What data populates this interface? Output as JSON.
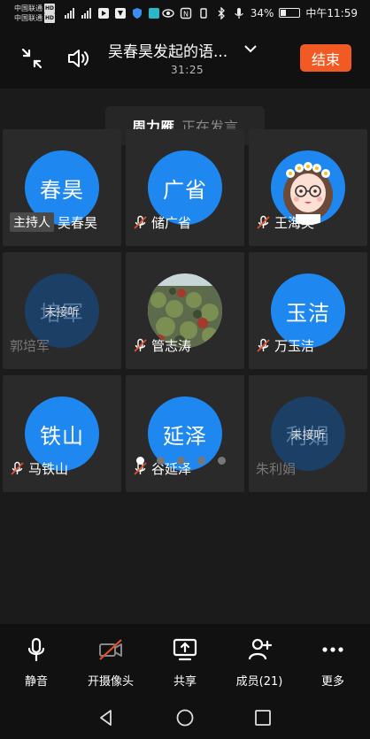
{
  "status_bar": {
    "carrier1": "中国联通",
    "carrier2": "中国联通",
    "hd": "HD",
    "battery": "34%",
    "time": "中午11:59"
  },
  "header": {
    "title": "吴春昊发起的语...",
    "timer": "31:25",
    "end_label": "结束"
  },
  "speaking": {
    "name": "周力雁",
    "status": "正在发言"
  },
  "participants": [
    {
      "avatar_text": "春昊",
      "name": "吴春昊",
      "host_badge": "主持人",
      "state": "joined"
    },
    {
      "avatar_text": "广省",
      "name": "储广省",
      "state": "joined",
      "muted": true
    },
    {
      "avatar_image": "cartoon-girl-flower-crown",
      "name": "王海英",
      "state": "joined",
      "muted": true
    },
    {
      "avatar_text": "培军",
      "name": "郭培军",
      "unanswered": "未接听",
      "state": "unanswered"
    },
    {
      "avatar_image": "ivy-wall-photo",
      "name": "管志涛",
      "state": "joined",
      "muted": true
    },
    {
      "avatar_text": "玉洁",
      "name": "万玉洁",
      "state": "joined",
      "muted": true
    },
    {
      "avatar_text": "铁山",
      "name": "马铁山",
      "state": "joined",
      "muted": true
    },
    {
      "avatar_text": "延泽",
      "name": "谷延泽",
      "state": "joined",
      "muted": true
    },
    {
      "avatar_text": "利娟",
      "name": "朱利娟",
      "unanswered": "未接听",
      "state": "unanswered"
    }
  ],
  "pager": {
    "pages": 5,
    "active": 0
  },
  "toolbar": {
    "mute": "静音",
    "camera": "开摄像头",
    "share": "共享",
    "members": "成员(21)",
    "more": "更多"
  },
  "colors": {
    "accent": "#1e87f0",
    "end_button": "#f25a24",
    "tile": "#2a2a2a",
    "mic_off": "#e0502a"
  }
}
